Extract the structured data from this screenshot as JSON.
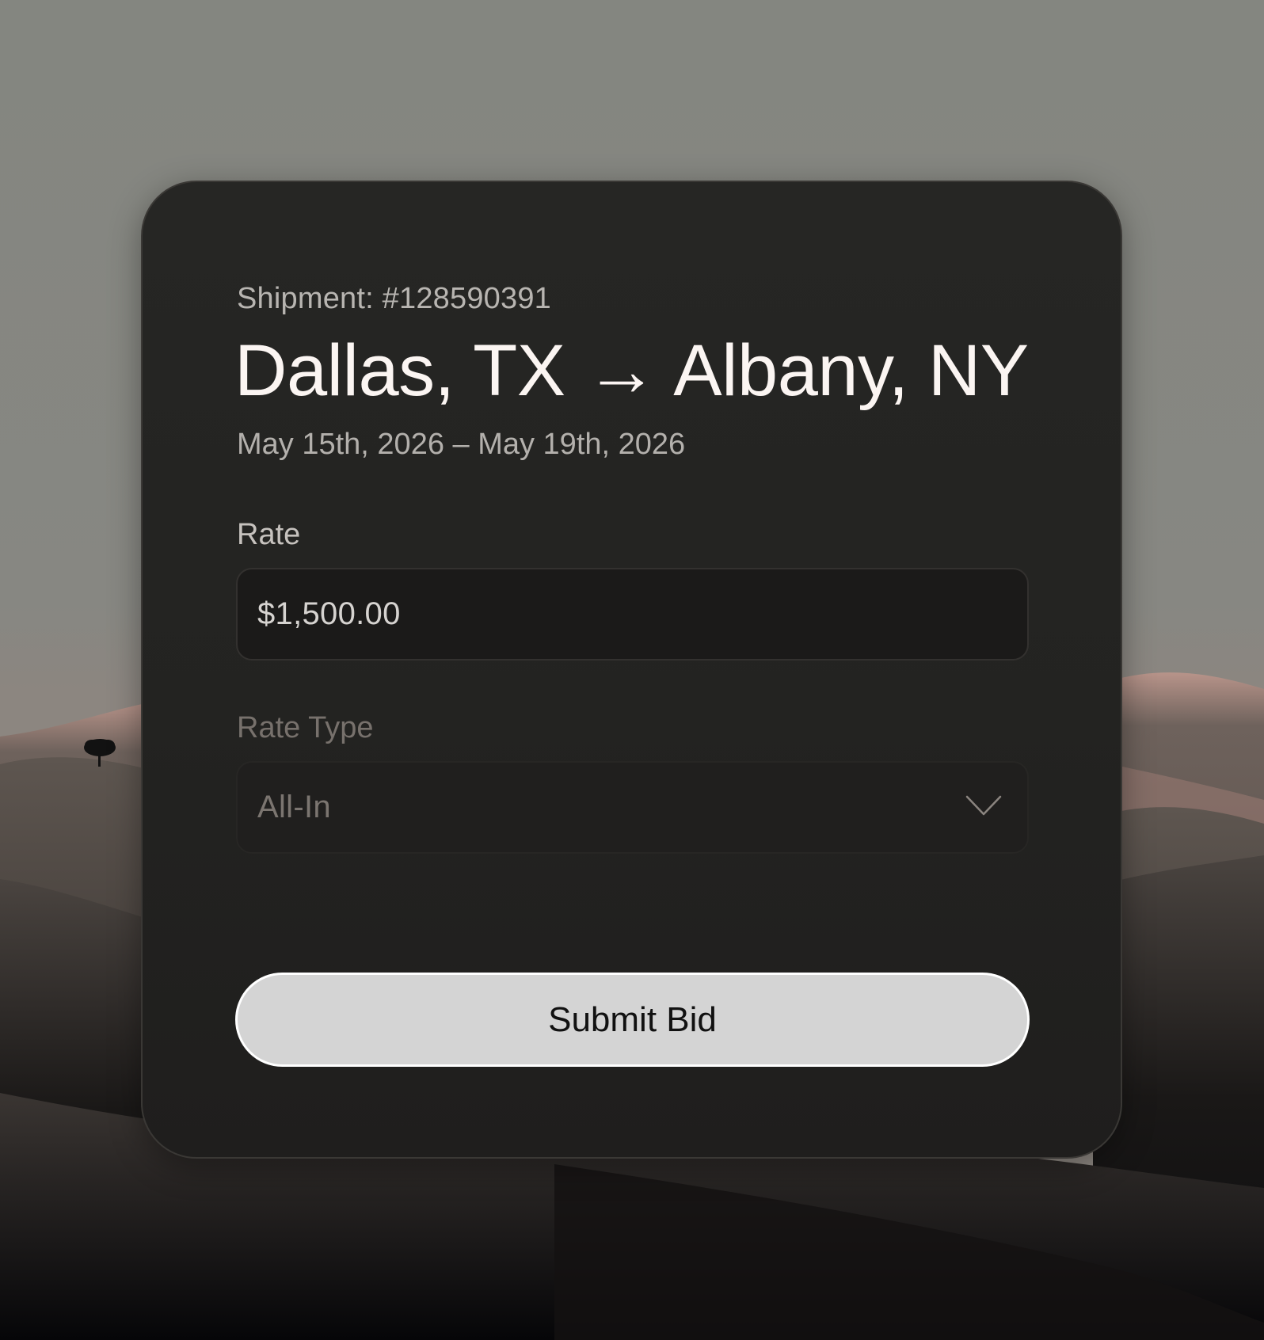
{
  "card": {
    "shipment_label": "Shipment: #128590391",
    "origin": "Dallas, TX",
    "arrow": "→",
    "destination": "Albany, NY",
    "date_range": "May 15th, 2026 – May 19th, 2026"
  },
  "rate": {
    "label": "Rate",
    "value": "$1,500.00"
  },
  "rate_type": {
    "label": "Rate Type",
    "selected": "All-In",
    "icon": "chevron-down-icon"
  },
  "submit": {
    "label": "Submit Bid"
  },
  "colors": {
    "card_bg": "#242422",
    "title_text": "#fbf5f2",
    "button_bg": "#d4d4d4"
  }
}
